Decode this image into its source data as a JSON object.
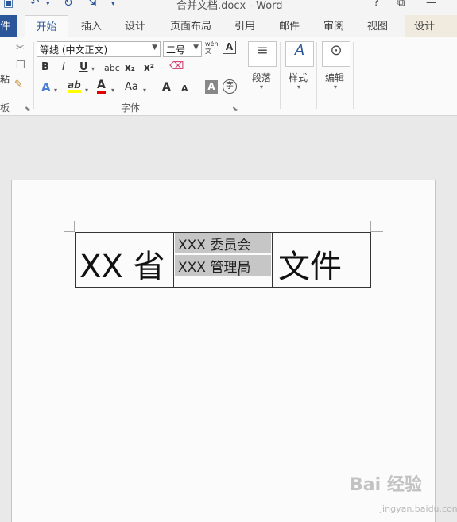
{
  "titlebar": {
    "title": "合并文档.docx - Word",
    "help": "?",
    "restore": "⧉",
    "minimize": "—"
  },
  "tabs": {
    "file": "件",
    "home": "开始",
    "insert": "插入",
    "design": "设计",
    "layout": "页面布局",
    "references": "引用",
    "mailings": "邮件",
    "review": "审阅",
    "view": "视图",
    "table_design": "设计"
  },
  "ribbon": {
    "clipboard_label": "板",
    "paste_partial": "粘",
    "font_name": "等线 (中文正文)",
    "font_size": "二号",
    "phonetic": "wén\n文",
    "bold": "B",
    "italic": "I",
    "underline": "U",
    "strike": "abc",
    "subscript": "x₂",
    "superscript": "x²",
    "font_group_label": "字体",
    "paragraph_label": "段落",
    "styles_label": "样式",
    "editing_label": "编辑",
    "change_case": "Aa",
    "grow_font": "A",
    "shrink_font": "A",
    "char_shading": "A",
    "enclose_char": "字",
    "text_effect": "A",
    "highlight": "ab",
    "font_color": "A"
  },
  "document": {
    "cell_left": "XX 省",
    "cell_mid_top": "XXX 委员会",
    "cell_mid_bottom": "XXX 管理局",
    "cell_right": "文件"
  },
  "watermark": {
    "main": "Bai 经验",
    "sub": "jingyan.baidu.com"
  },
  "colors": {
    "accent": "#2b579a",
    "highlight": "#ffff00",
    "font_red": "#e00000",
    "selection": "#c6c6c6"
  }
}
